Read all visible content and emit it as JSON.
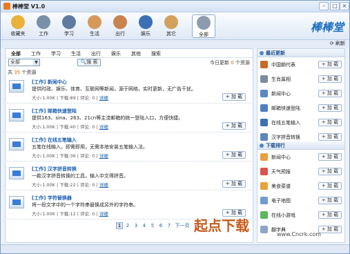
{
  "window": {
    "title": "棒棒堂 V1.0"
  },
  "toolbar": {
    "items": [
      {
        "label": "收藏夹",
        "icon": "favorites-icon",
        "color": "#e9b23a"
      },
      {
        "label": "工作",
        "icon": "work-icon",
        "color": "#7a8fa8"
      },
      {
        "label": "学习",
        "icon": "study-icon",
        "color": "#5d7aa0"
      },
      {
        "label": "生活",
        "icon": "life-icon",
        "color": "#d79a5a"
      },
      {
        "label": "出行",
        "icon": "travel-icon",
        "color": "#c9834c"
      },
      {
        "label": "娱乐",
        "icon": "entertainment-icon",
        "color": "#3c6fb4"
      },
      {
        "label": "其它",
        "icon": "other-icon",
        "color": "#d2a15e"
      },
      {
        "label": "全部",
        "icon": "all-icon",
        "color": "#8c9cae"
      }
    ],
    "logo": "棒棒堂",
    "refresh": "刷新"
  },
  "categories": [
    "全部",
    "工作",
    "学习",
    "生活",
    "出行",
    "娱乐",
    "其他",
    "搜索"
  ],
  "search": {
    "select_value": "全部",
    "button": "搜 索"
  },
  "update": {
    "prefix": "今日更新",
    "count": "0",
    "suffix": "个资源"
  },
  "total": {
    "prefix": "共",
    "count": "35",
    "suffix": "个资源"
  },
  "items": [
    {
      "name": "[工作] 新闻中心",
      "desc": "提供时政、娱乐、体育、互联网等新闻，源于网络，实时更新，无广告干扰。",
      "meta": "大小:1.00K  |  下载:89  |  评论: 0  |  ",
      "detail": "详细",
      "add": "+ 加  载"
    },
    {
      "name": "[工作] 邮箱快速登陆",
      "desc": "提供163、sina、263、21cn等主流邮箱的统一登陆入口，方便快捷。",
      "meta": "大小:1.00K  |  下载:40  |  评论: 0  |  ",
      "detail": "详细",
      "add": "+ 加  载"
    },
    {
      "name": "[工作] 在线五笔输入",
      "desc": "五笔在线输入，即需即用，无需本地安装五笔输入法。",
      "meta": "大小:1.00K  |  下载:36  |  评论: 0  |  ",
      "detail": "详细",
      "add": "+ 加  载"
    },
    {
      "name": "[工作] 汉字拼音转换",
      "desc": "一款汉字拼音转换的工具，输入中文得拼音。",
      "meta": "大小:1.00K  |  下载:22  |  评论: 0  |  ",
      "detail": "详细",
      "add": "+ 加  载"
    },
    {
      "name": "[工作] 字符替换器",
      "desc": "将一段文字中的一个字符串替换成另外的字符串。",
      "meta": "大小:1.00K  |  下载:12  |  评论: 0  |  ",
      "detail": "详细",
      "add": "+ 加  载"
    }
  ],
  "pager": [
    "1",
    "2",
    "3",
    "4",
    "5",
    "6",
    "7",
    "下一页"
  ],
  "side": {
    "latest_title": "最近更新",
    "latest": [
      {
        "name": "中国朝代表",
        "color": "#c56b2d",
        "add": "+ 加  载"
      },
      {
        "name": "生肖属相",
        "color": "#7d8b9e",
        "add": "+ 加  载"
      },
      {
        "name": "新闻中心",
        "color": "#5b87c2",
        "add": "+ 加  载"
      },
      {
        "name": "邮箱快速登陆",
        "color": "#4f7fbf",
        "add": "+ 加  载"
      },
      {
        "name": "在线五笔输入",
        "color": "#3c6fb4",
        "add": "+ 加  载"
      },
      {
        "name": "汉字拼音转换",
        "color": "#5d86bd",
        "add": "+ 加  载"
      }
    ],
    "ranking_title": "下载排行",
    "ranking": [
      {
        "name": "新闻中心",
        "color": "#e8a040",
        "add": "+ 加  载"
      },
      {
        "name": "天气预报",
        "color": "#d9534f",
        "add": "+ 加  载"
      },
      {
        "name": "美食菜谱",
        "color": "#e9a23b",
        "add": "+ 加  载"
      },
      {
        "name": "电子地图",
        "color": "#6f9bd1",
        "add": "+ 加  载"
      },
      {
        "name": "在线小游戏",
        "color": "#5cb85c",
        "add": "+ 加  载"
      },
      {
        "name": "翻字典",
        "color": "#8fa6c4",
        "add": "+ 加  载"
      }
    ]
  },
  "watermark": {
    "big": "起点下载",
    "url": "www.Cncrk.com"
  }
}
